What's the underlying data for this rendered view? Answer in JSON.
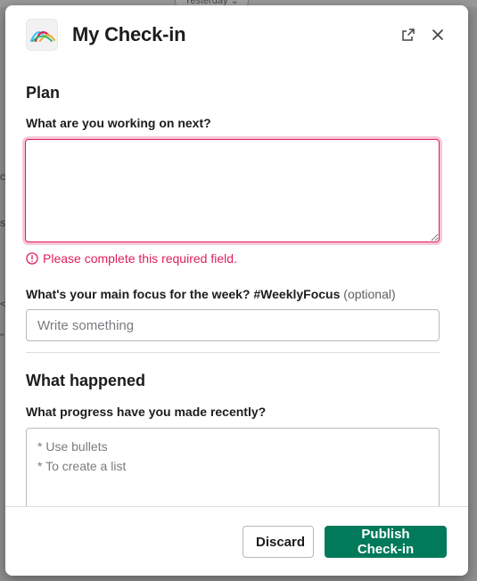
{
  "backdrop": {
    "chip_label": "Yesterday ⌄",
    "side_letters": [
      "c",
      "s",
      "<",
      "\""
    ]
  },
  "modal": {
    "title": "My Check-in",
    "open_external_label": "Open in new window",
    "close_label": "Close"
  },
  "plan": {
    "section_title": "Plan",
    "working_on_label": "What are you working on next?",
    "working_on_value": "",
    "error_message": "Please complete this required field.",
    "focus_label": "What's your main focus for the week? #WeeklyFocus",
    "focus_optional": "(optional)",
    "focus_value": "",
    "focus_placeholder": "Write something"
  },
  "happened": {
    "section_title": "What happened",
    "progress_label": "What progress have you made recently?",
    "progress_value": "",
    "progress_placeholder": "* Use bullets\n* To create a list"
  },
  "footer": {
    "discard_label": "Discard",
    "publish_label": "Publish Check-in"
  },
  "colors": {
    "accent_green": "#007a5a",
    "error_red": "#e01e5a",
    "text_primary": "#1d1c1d"
  }
}
